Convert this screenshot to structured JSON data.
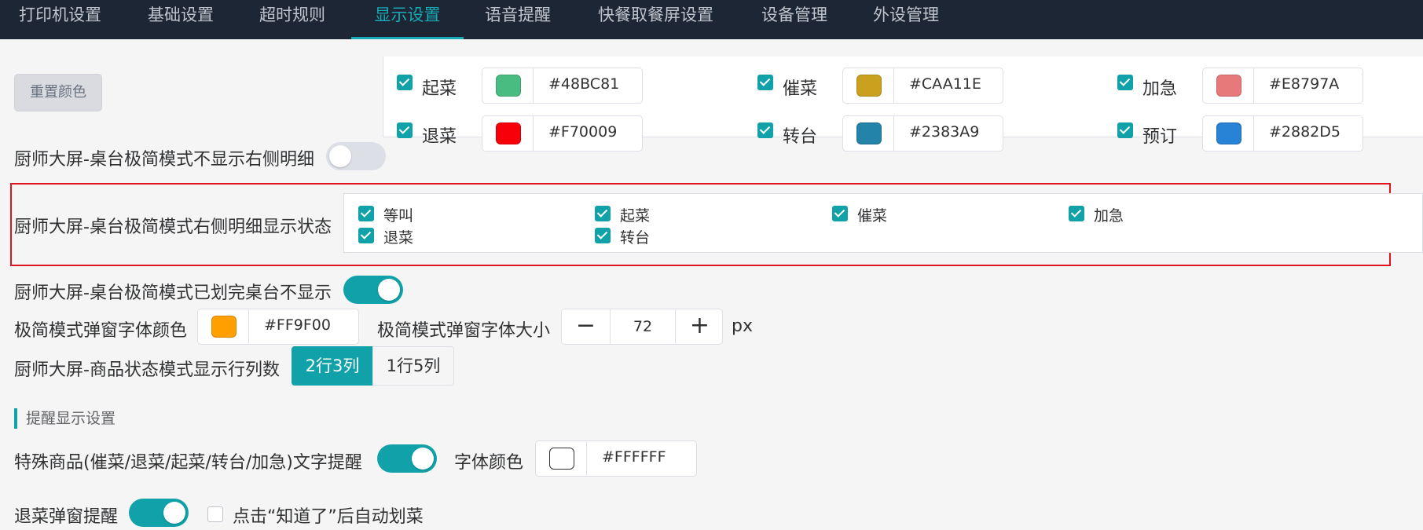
{
  "tabs": [
    {
      "label": "打印机设置",
      "active": false
    },
    {
      "label": "基础设置",
      "active": false
    },
    {
      "label": "超时规则",
      "active": false
    },
    {
      "label": "显示设置",
      "active": true
    },
    {
      "label": "语音提醒",
      "active": false
    },
    {
      "label": "快餐取餐屏设置",
      "active": false
    },
    {
      "label": "设备管理",
      "active": false
    },
    {
      "label": "外设管理",
      "active": false
    }
  ],
  "colors": {
    "accent": "#10A1A9",
    "topbar": "#1D2634",
    "highlight": "#E0141D"
  },
  "reset_button": "重置颜色",
  "status_colors": [
    {
      "label": "起菜",
      "hex": "#48BC81",
      "checked": true
    },
    {
      "label": "催菜",
      "hex": "#CAA11E",
      "checked": true
    },
    {
      "label": "加急",
      "hex": "#E8797A",
      "checked": true
    },
    {
      "label": "退菜",
      "hex": "#F70009",
      "checked": true
    },
    {
      "label": "转台",
      "hex": "#2383A9",
      "checked": true
    },
    {
      "label": "预订",
      "hex": "#2882D5",
      "checked": true
    }
  ],
  "settings": {
    "hide_detail_label": "厨师大屏-桌台极简模式不显示右侧明细",
    "hide_detail_on": false,
    "detail_status_label": "厨师大屏-桌台极简模式右侧明细显示状态",
    "detail_status_items": [
      {
        "label": "等叫",
        "checked": true
      },
      {
        "label": "起菜",
        "checked": true
      },
      {
        "label": "催菜",
        "checked": true
      },
      {
        "label": "加急",
        "checked": true
      },
      {
        "label": "退菜",
        "checked": true
      },
      {
        "label": "转台",
        "checked": true
      }
    ],
    "hide_finished_label": "厨师大屏-桌台极简模式已划完桌台不显示",
    "hide_finished_on": true,
    "popup_font_color_label": "极简模式弹窗字体颜色",
    "popup_font_color": "#FF9F00",
    "popup_font_size_label": "极简模式弹窗字体大小",
    "popup_font_size": "72",
    "popup_font_size_unit": "px",
    "minus_glyph": "−",
    "plus_glyph": "+",
    "layout_label": "厨师大屏-商品状态模式显示行列数",
    "layout_options": [
      "2行3列",
      "1行5列"
    ],
    "layout_selected": "2行3列"
  },
  "reminder_section": {
    "title": "提醒显示设置",
    "special_label": "特殊商品(催菜/退菜/起菜/转台/加急)文字提醒",
    "special_on": true,
    "font_color_label": "字体颜色",
    "font_color": "#FFFFFF",
    "return_popup_label": "退菜弹窗提醒",
    "return_popup_on": true,
    "auto_finish_label": "点击“知道了”后自动划菜",
    "auto_finish_checked": false
  }
}
